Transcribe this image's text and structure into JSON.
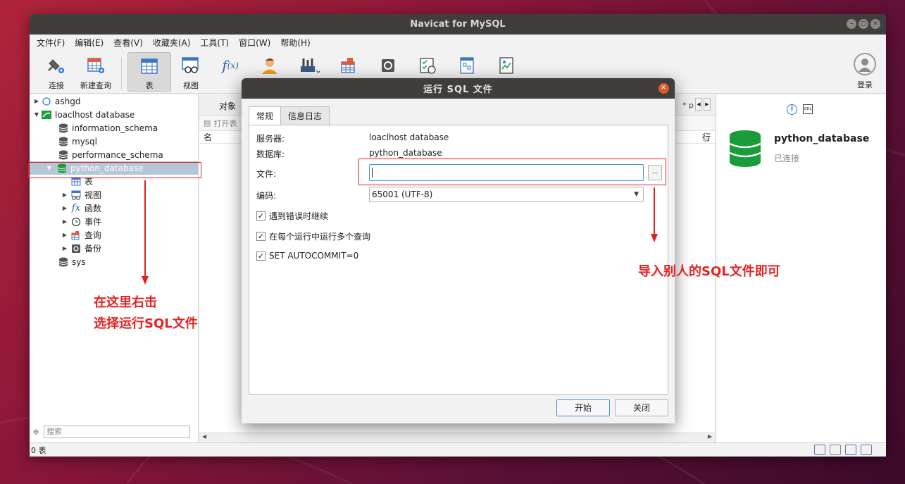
{
  "window": {
    "title": "Navicat for MySQL"
  },
  "menu": [
    "文件(F)",
    "编辑(E)",
    "查看(V)",
    "收藏夹(A)",
    "工具(T)",
    "窗口(W)",
    "帮助(H)"
  ],
  "toolbar": {
    "connect": "连接",
    "new_query": "新建查询",
    "table": "表",
    "view": "视图",
    "login": "登录"
  },
  "tree": {
    "items": [
      {
        "label": "ashgd"
      },
      {
        "label": "loaclhost database"
      },
      {
        "label": "information_schema"
      },
      {
        "label": "mysql"
      },
      {
        "label": "performance_schema"
      },
      {
        "label": "python_database"
      },
      {
        "label": "表"
      },
      {
        "label": "视图"
      },
      {
        "label": "函数"
      },
      {
        "label": "事件"
      },
      {
        "label": "查询"
      },
      {
        "label": "备份"
      },
      {
        "label": "sys"
      }
    ],
    "search_placeholder": "搜索"
  },
  "middle": {
    "tab": "对象",
    "open_table": "打开表",
    "col_name": "名",
    "col_row": "行",
    "tab_star": "* p"
  },
  "info": {
    "db_name": "python_database",
    "status": "已连接",
    "ddl": "DDL"
  },
  "statusbar": {
    "count": "0 表"
  },
  "dialog": {
    "title": "运行 SQL 文件",
    "tabs": [
      "常规",
      "信息日志"
    ],
    "server_label": "服务器:",
    "server_value": "loaclhost database",
    "database_label": "数据库:",
    "database_value": "python_database",
    "file_label": "文件:",
    "file_value": "",
    "browse": "...",
    "encoding_label": "编码:",
    "encoding_value": "65001 (UTF-8)",
    "checks": [
      {
        "label": "遇到错误时继续",
        "checked": true
      },
      {
        "label": "在每个运行中运行多个查询",
        "checked": true
      },
      {
        "label": "SET AUTOCOMMIT=0",
        "checked": true
      }
    ],
    "start": "开始",
    "close": "关闭"
  },
  "annotations": {
    "left_line1": "在这里右击",
    "left_line2": "选择运行SQL文件",
    "right": "导入别人的SQL文件即可"
  },
  "colors": {
    "accent_red": "#e02020",
    "db_green": "#1a9c3a",
    "titlebar": "#403e3c"
  }
}
